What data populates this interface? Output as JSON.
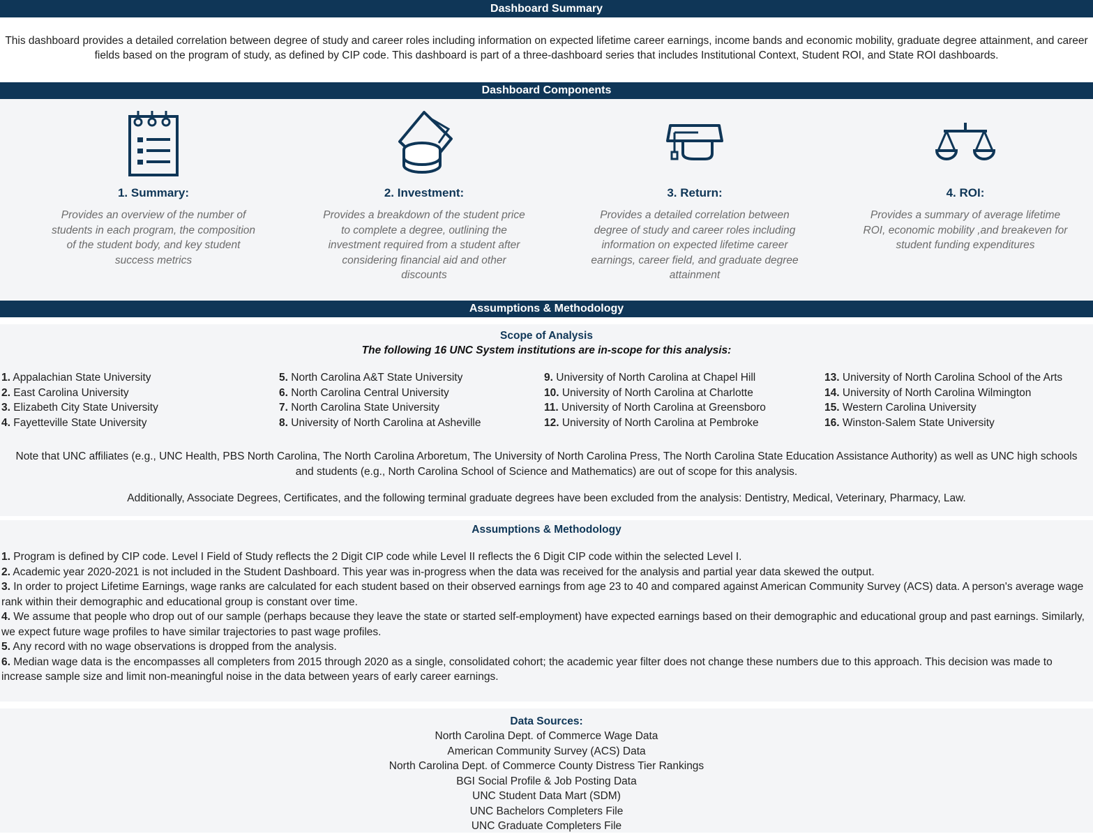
{
  "summary": {
    "header": "Dashboard Summary",
    "text": "This dashboard provides a detailed correlation between degree of study and career roles including information on expected lifetime career earnings, income bands and economic mobility, graduate degree attainment, and career fields based on the program of study, as defined by CIP code. This dashboard is part of a three-dashboard series that includes Institutional Context, Student ROI, and State ROI dashboards."
  },
  "components": {
    "header": "Dashboard Components",
    "items": [
      {
        "title": "1. Summary:",
        "icon": "checklist-icon",
        "desc": "Provides an overview of the number of students in each program, the composition of the student body, and key student success metrics"
      },
      {
        "title": "2. Investment:",
        "icon": "coins-cash-icon",
        "desc": "Provides a breakdown of the student price to complete a degree, outlining the investment required from a student after considering financial aid and other discounts"
      },
      {
        "title": "3. Return:",
        "icon": "graduation-cap-icon",
        "desc": "Provides a detailed correlation between degree of study and career roles including information on expected lifetime career earnings, career field, and graduate degree attainment"
      },
      {
        "title": "4. ROI:",
        "icon": "scales-icon",
        "desc": "Provides a summary of average lifetime ROI, economic mobility ,and breakeven for student funding expenditures"
      }
    ]
  },
  "methodology": {
    "header": "Assumptions & Methodology",
    "scope_title": "Scope of Analysis",
    "scope_subtitle": "The following 16 UNC System institutions are in-scope for this analysis:",
    "institutions": [
      [
        {
          "num": "1.",
          "name": "Appalachian State University"
        },
        {
          "num": "2.",
          "name": "East Carolina University"
        },
        {
          "num": "3.",
          "name": "Elizabeth City State University"
        },
        {
          "num": "4.",
          "name": "Fayetteville State University"
        }
      ],
      [
        {
          "num": "5.",
          "name": "North Carolina A&T State University"
        },
        {
          "num": "6.",
          "name": "North Carolina Central University"
        },
        {
          "num": "7.",
          "name": "North Carolina State University"
        },
        {
          "num": "8.",
          "name": "University of North Carolina at Asheville"
        }
      ],
      [
        {
          "num": "9.",
          "name": "University of North Carolina at Chapel Hill"
        },
        {
          "num": "10.",
          "name": "University of North Carolina at Charlotte"
        },
        {
          "num": "11.",
          "name": "University of North Carolina at Greensboro"
        },
        {
          "num": "12.",
          "name": "University of North Carolina at Pembroke"
        }
      ],
      [
        {
          "num": "13.",
          "name": "University of North Carolina School of the Arts"
        },
        {
          "num": "14.",
          "name": "University of North Carolina Wilmington"
        },
        {
          "num": "15.",
          "name": "Western Carolina University"
        },
        {
          "num": "16.",
          "name": "Winston-Salem State University"
        }
      ]
    ],
    "note1": "Note that UNC affiliates (e.g., UNC Health, PBS North Carolina, The North Carolina Arboretum, The University of North Carolina Press, The North Carolina State Education Assistance Authority) as well as UNC high schools and students (e.g., North Carolina School of Science and Mathematics) are out of scope for this analysis.",
    "note2": "Additionally, Associate Degrees, Certificates, and the following terminal graduate degrees have been excluded from the analysis: Dentistry, Medical, Veterinary, Pharmacy, Law.",
    "am_title": "Assumptions & Methodology",
    "assumptions": [
      {
        "num": "1.",
        "text": "Program is defined by CIP code. Level I Field of Study reflects the 2 Digit CIP code while Level II reflects the 6 Digit CIP code within the selected Level I."
      },
      {
        "num": "2.",
        "text": "Academic year 2020-2021 is not included in the Student Dashboard. This year was in-progress when the data was received for the analysis and partial year data skewed the output."
      },
      {
        "num": "3.",
        "text": "In order to project Lifetime Earnings, wage ranks are calculated for each student based on their observed earnings from age 23 to 40 and compared against American Community Survey (ACS) data. A person's average wage rank within their demographic and educational group is constant over time."
      },
      {
        "num": "4.",
        "text": "We assume that people who drop out of our sample (perhaps because they leave the state or started self-employment) have expected earnings based on their demographic and educational group and past earnings. Similarly, we expect future wage profiles to have similar trajectories to past wage profiles."
      },
      {
        "num": "5.",
        "text": "Any record with no wage observations is dropped from the analysis."
      },
      {
        "num": "6.",
        "text": "Median wage data is the encompasses all completers from 2015 through 2020 as a single, consolidated cohort; the academic year filter does not change these numbers due to this approach. This decision was made to increase sample size and limit non-meaningful noise in the data between years of early career earnings."
      }
    ]
  },
  "data_sources": {
    "title": "Data Sources:",
    "items": [
      "North Carolina Dept. of Commerce Wage Data",
      "American Community Survey (ACS) Data",
      "North Carolina Dept. of Commerce County Distress Tier Rankings",
      "BGI Social Profile & Job Posting Data",
      "UNC Student Data Mart (SDM)",
      "UNC Bachelors Completers File",
      "UNC Graduate Completers File"
    ]
  },
  "colors": {
    "navy": "#0f3657",
    "grey_panel": "#f4f5f7",
    "desc_text": "#6b6b6b"
  }
}
